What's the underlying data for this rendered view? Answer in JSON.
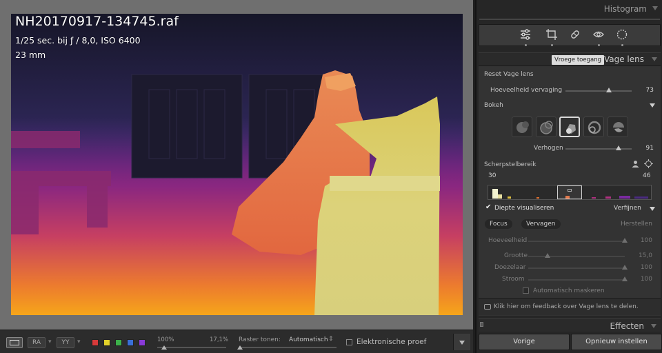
{
  "photo": {
    "filename": "NH20170917-134745.raf",
    "exposure": "1/25 sec. bij ƒ / 8,0, ISO 6400",
    "focal_length": "23 mm"
  },
  "toolbar": {
    "compare_label": "RA",
    "survey_label": "YY",
    "zoom_value": "100%",
    "zoom_fit": "17,1%",
    "grid_label": "Raster tonen:",
    "grid_value": "Automatisch",
    "softproof_label": "Elektronische proef",
    "color_labels": [
      "#d83a3a",
      "#e3d22a",
      "#3cb14a",
      "#3a6fd8",
      "#8a3ad8"
    ]
  },
  "panel": {
    "histogram_label": "Histogram",
    "tools": [
      "sliders-icon",
      "crop-icon",
      "healing-icon",
      "redeye-icon",
      "mask-icon"
    ],
    "early_access": "Vroege toegang",
    "section_title": "Vage lens",
    "reset_label": "Reset Vage lens",
    "blur_amount_label": "Hoeveelheid vervaging",
    "blur_amount_value": "73",
    "blur_amount_level": 0.73,
    "bokeh_label": "Bokeh",
    "bokeh_types": [
      "circle",
      "soap-bubble",
      "blade",
      "ring",
      "cat-eye"
    ],
    "bokeh_selected": 2,
    "boost_label": "Verhogen",
    "boost_value": "91",
    "boost_level": 0.91,
    "focal_range_label": "Scherpstelbereik",
    "focal_range_min": "30",
    "focal_range_max": "46",
    "visualize_label": "Diepte visualiseren",
    "refine_label": "Verfijnen",
    "focus_btn": "Focus",
    "blur_btn": "Vervagen",
    "restore_label": "Herstellen",
    "amount_label": "Hoeveelheid",
    "amount_value": "100",
    "size_label": "Grootte",
    "size_value": "15,0",
    "feather_label": "Doezelaar",
    "feather_value": "100",
    "flow_label": "Stroom",
    "flow_value": "100",
    "automask_label": "Automatisch maskeren",
    "feedback_text": "Klik hier om feedback over Vage lens te delen.",
    "effects_label": "Effecten",
    "previous_btn": "Vorige",
    "reset_btn": "Opnieuw instellen"
  }
}
